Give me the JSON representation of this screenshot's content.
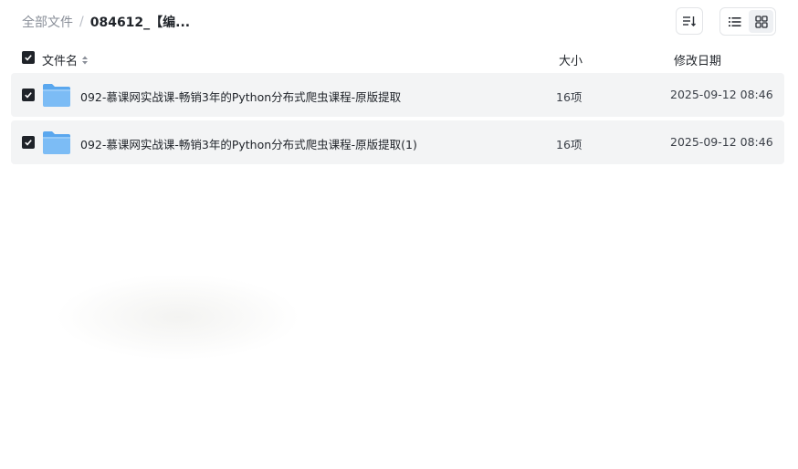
{
  "breadcrumb": {
    "root": "全部文件",
    "separator": "/",
    "current": "084612_【编..."
  },
  "toolbar": {
    "sort_icon": "sort-list-icon",
    "list_view_icon": "list-view-icon",
    "grid_view_icon": "grid-view-icon",
    "active_view": "list"
  },
  "table": {
    "columns": {
      "name": "文件名",
      "size": "大小",
      "date": "修改日期"
    },
    "rows": [
      {
        "name": "092-慕课网实战课-畅销3年的Python分布式爬虫课程-原版提取",
        "size": "16项",
        "date": "2025-09-12 08:46",
        "selected": true,
        "icon": "folder-icon"
      },
      {
        "name": "092-慕课网实战课-畅销3年的Python分布式爬虫课程-原版提取(1)",
        "size": "16项",
        "date": "2025-09-12 08:46",
        "selected": true,
        "icon": "folder-icon"
      }
    ]
  },
  "colors": {
    "row_background": "#f3f4f5",
    "checkbox": "#1f2329",
    "folder": "#6fb3f2"
  }
}
